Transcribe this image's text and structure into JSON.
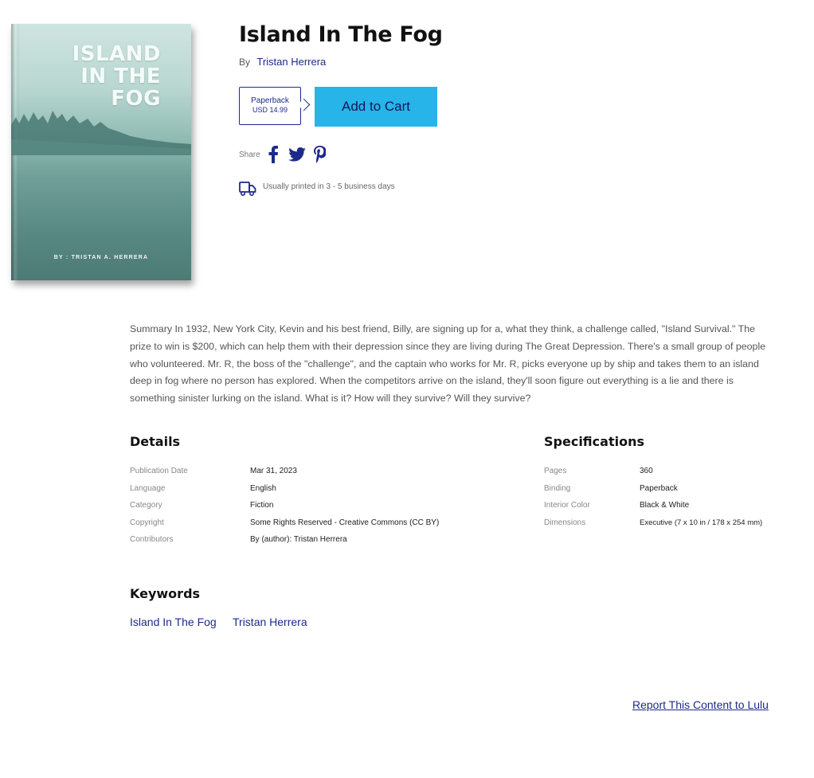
{
  "cover": {
    "title_lines": "ISLAND\nIN THE\nFOG",
    "author": "BY : TRISTAN A. HERRERA"
  },
  "book": {
    "title": "Island In The Fog",
    "by_label": "By",
    "author": "Tristan Herrera"
  },
  "format": {
    "type": "Paperback",
    "price": "USD 14.99"
  },
  "cart": {
    "label": "Add to Cart",
    "color": "#27b4e8"
  },
  "share": {
    "label": "Share",
    "icons": [
      "facebook-icon",
      "twitter-icon",
      "pinterest-icon"
    ]
  },
  "shipping": {
    "text": "Usually printed in 3 - 5 business days"
  },
  "summary": "Summary In 1932, New York City, Kevin and his best friend, Billy, are signing up for a, what they think, a challenge called, \"Island Survival.\" The prize to win is $200, which can help them with their depression since they are living during The Great Depression. There's a small group of people who volunteered. Mr. R, the boss of the \"challenge\", and the captain who works for Mr. R, picks everyone up by ship and takes them to an island deep in fog where no person has explored. When the competitors arrive on the island, they'll soon figure out everything is a lie and there is something sinister lurking on the island. What is it? How will they survive? Will they survive?",
  "details": {
    "heading": "Details",
    "rows": [
      {
        "label": "Publication Date",
        "value": "Mar 31, 2023"
      },
      {
        "label": "Language",
        "value": "English"
      },
      {
        "label": "Category",
        "value": "Fiction"
      },
      {
        "label": "Copyright",
        "value": "Some Rights Reserved - Creative Commons (CC BY)"
      },
      {
        "label": "Contributors",
        "value": "By (author): Tristan Herrera"
      }
    ]
  },
  "specifications": {
    "heading": "Specifications",
    "rows": [
      {
        "label": "Pages",
        "value": "360"
      },
      {
        "label": "Binding",
        "value": "Paperback"
      },
      {
        "label": "Interior Color",
        "value": "Black & White"
      },
      {
        "label": "Dimensions",
        "value": "Executive (7 x 10 in / 178 x 254 mm)"
      }
    ]
  },
  "keywords": {
    "heading": "Keywords",
    "items": [
      "Island In The Fog",
      "Tristan Herrera"
    ]
  },
  "report_link": "Report This Content to Lulu",
  "colors": {
    "link": "#1d2a8a",
    "accent": "#27b4e8"
  }
}
